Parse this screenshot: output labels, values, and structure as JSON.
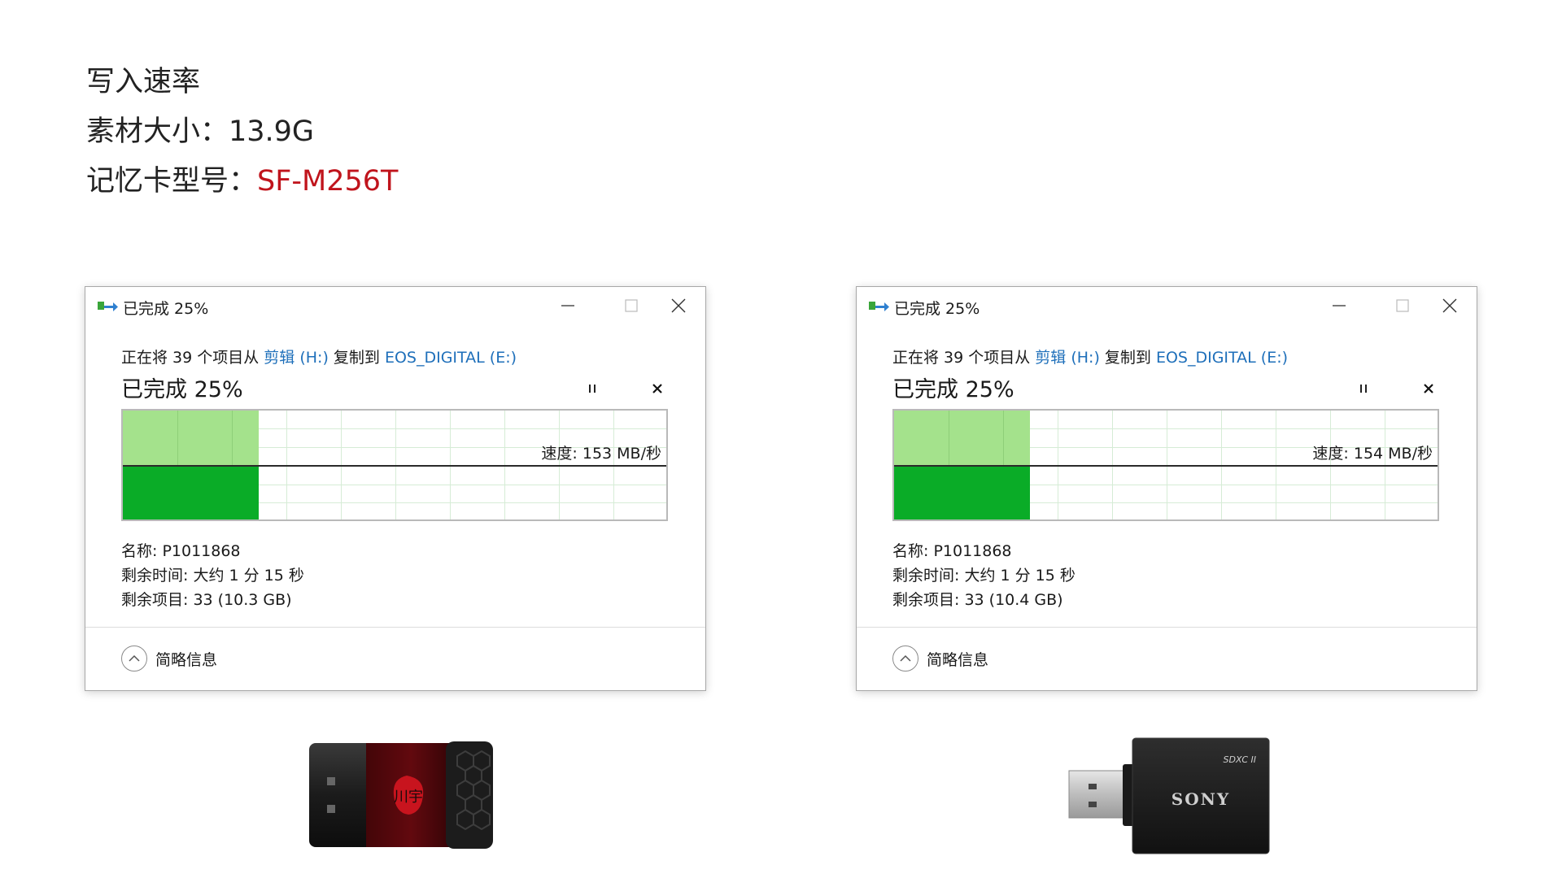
{
  "header": {
    "line1": "写入速率",
    "line2": "素材大小：13.9G",
    "line3_label": "记忆卡型号：",
    "line3_value": "SF-M256T",
    "accent_color": "#c0141c"
  },
  "dialogs": [
    {
      "title": "已完成 25%",
      "desc_prefix": "正在将 39 个项目从 ",
      "source_link": "剪辑 (H:)",
      "desc_mid": " 复制到 ",
      "dest_link": "EOS_DIGITAL (E:)",
      "progress_heading": "已完成 25%",
      "progress_percent": 25,
      "speed": "速度: 153 MB/秒",
      "name": "名称: P1011868",
      "time_remaining": "剩余时间: 大约 1 分 15 秒",
      "items_remaining": "剩余项目: 33 (10.3 GB)",
      "footer_label": "简略信息"
    },
    {
      "title": "已完成 25%",
      "desc_prefix": "正在将 39 个项目从 ",
      "source_link": "剪辑 (H:)",
      "desc_mid": " 复制到 ",
      "dest_link": "EOS_DIGITAL (E:)",
      "progress_heading": "已完成 25%",
      "progress_percent": 25,
      "speed": "速度: 154 MB/秒",
      "name": "名称: P1011868",
      "time_remaining": "剩余时间: 大约 1 分 15 秒",
      "items_remaining": "剩余项目: 33 (10.4 GB)",
      "footer_label": "简略信息"
    }
  ],
  "devices": {
    "left_brand": "川宇",
    "right_brand": "SONY",
    "right_badge": "SDXC II"
  },
  "colors": {
    "graph_fill_light": "#a4e28c",
    "graph_fill_dark": "#0aac27",
    "link": "#1e6fba"
  }
}
